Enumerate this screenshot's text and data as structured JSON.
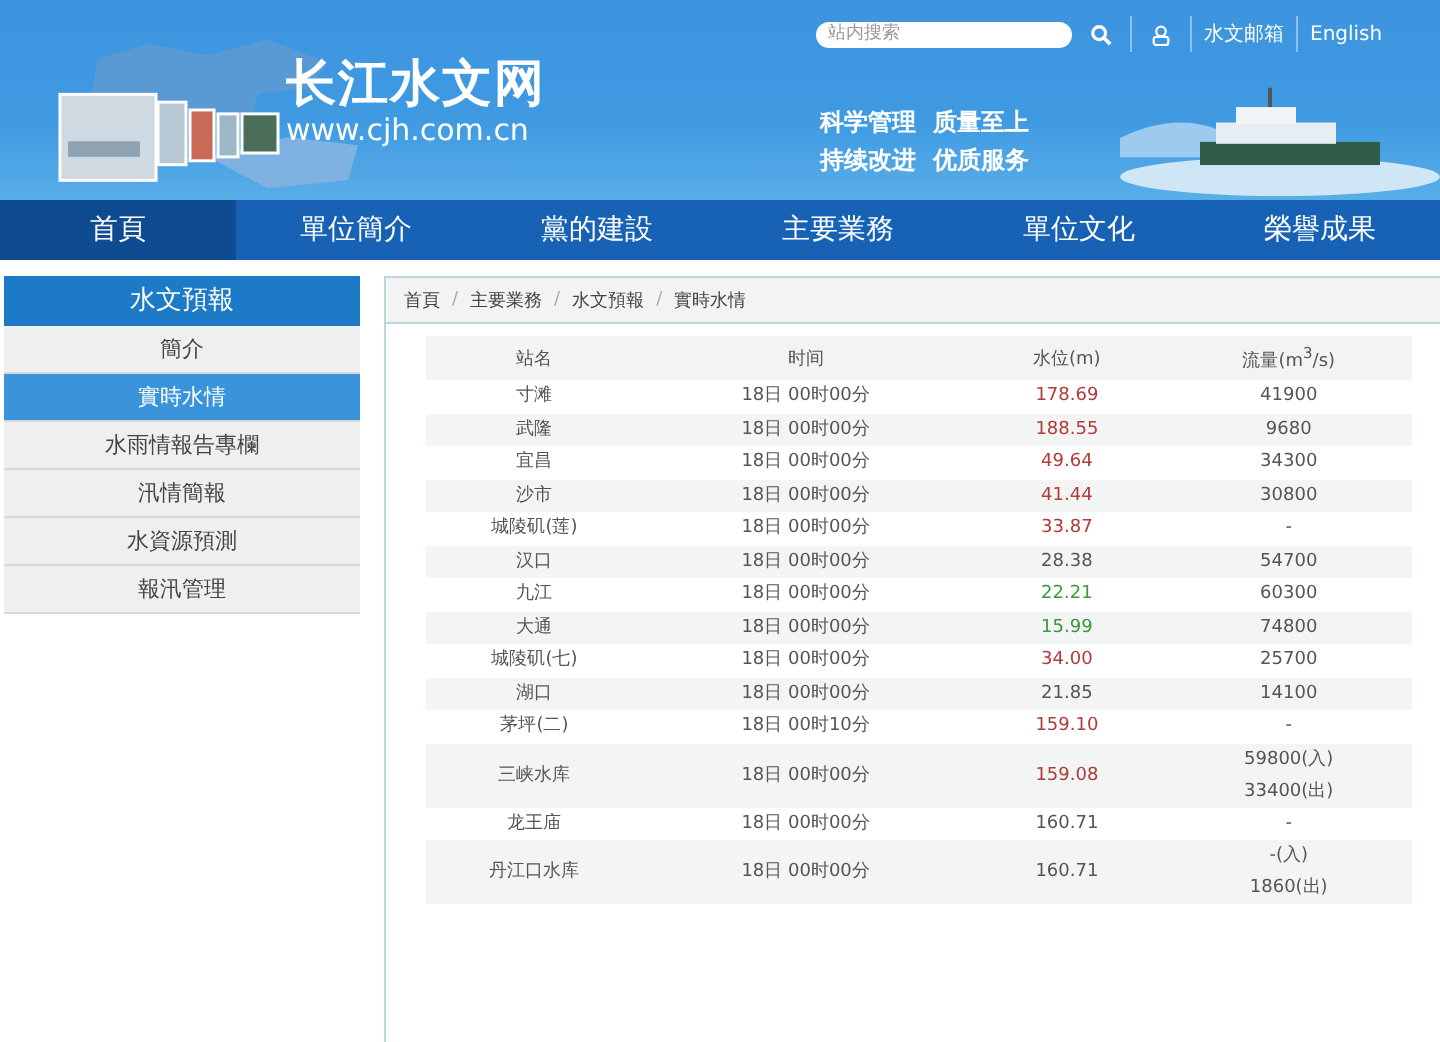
{
  "header": {
    "search": {
      "placeholder": "站内搜索"
    },
    "links": [
      "水文邮箱",
      "English"
    ],
    "logo_title": "长江水文网",
    "logo_url": "www.cjh.com.cn",
    "slogans": [
      "科学管理  质量至上",
      "持续改进  优质服务"
    ]
  },
  "nav": [
    {
      "label": "首頁",
      "selected": true
    },
    {
      "label": "單位簡介",
      "selected": false
    },
    {
      "label": "黨的建設",
      "selected": false
    },
    {
      "label": "主要業務",
      "selected": false
    },
    {
      "label": "單位文化",
      "selected": false
    },
    {
      "label": "榮譽成果",
      "selected": false
    }
  ],
  "sidebar": {
    "title": "水文預報",
    "items": [
      {
        "label": "簡介",
        "selected": false
      },
      {
        "label": "實時水情",
        "selected": true
      },
      {
        "label": "水雨情報告專欄",
        "selected": false
      },
      {
        "label": "汛情簡報",
        "selected": false
      },
      {
        "label": "水資源預測",
        "selected": false
      },
      {
        "label": "報汛管理",
        "selected": false
      }
    ]
  },
  "breadcrumb": [
    {
      "kind": "link",
      "text": "首頁"
    },
    {
      "kind": "separator",
      "text": "/"
    },
    {
      "kind": "link",
      "text": "主要業務"
    },
    {
      "kind": "separator",
      "text": "/"
    },
    {
      "kind": "link",
      "text": "水文預報"
    },
    {
      "kind": "separator",
      "text": "/"
    },
    {
      "kind": "link",
      "text": "實時水情"
    }
  ],
  "table": {
    "columns": [
      "站名",
      "时间",
      "水位(m)",
      "流量(m$^{3}$/s)"
    ],
    "rows": [
      {
        "station": "寸滩",
        "time": "18日 00时00分",
        "level_m": "178.69",
        "color": "#b23b3b",
        "flow": [
          "41900"
        ]
      },
      {
        "station": "武隆",
        "time": "18日 00时00分",
        "level_m": "188.55",
        "color": "#b23b3b",
        "flow": [
          "9680"
        ]
      },
      {
        "station": "宜昌",
        "time": "18日 00时00分",
        "level_m": "49.64",
        "color": "#b23b3b",
        "flow": [
          "34300"
        ]
      },
      {
        "station": "沙市",
        "time": "18日 00时00分",
        "level_m": "41.44",
        "color": "#b23b3b",
        "flow": [
          "30800"
        ]
      },
      {
        "station": "城陵矶(莲)",
        "time": "18日 00时00分",
        "level_m": "33.87",
        "color": "#b23b3b",
        "flow": [
          "-"
        ]
      },
      {
        "station": "汉口",
        "time": "18日 00时00分",
        "level_m": "28.38",
        "color": "#555555",
        "flow": [
          "54700"
        ]
      },
      {
        "station": "九江",
        "time": "18日 00时00分",
        "level_m": "22.21",
        "color": "#3a983a",
        "flow": [
          "60300"
        ]
      },
      {
        "station": "大通",
        "time": "18日 00时00分",
        "level_m": "15.99",
        "color": "#3a983a",
        "flow": [
          "74800"
        ]
      },
      {
        "station": "城陵矶(七)",
        "time": "18日 00时00分",
        "level_m": "34.00",
        "color": "#b23b3b",
        "flow": [
          "25700"
        ]
      },
      {
        "station": "湖口",
        "time": "18日 00时00分",
        "level_m": "21.85",
        "color": "#555555",
        "flow": [
          "14100"
        ]
      },
      {
        "station": "茅坪(二)",
        "time": "18日 00时10分",
        "level_m": "159.10",
        "color": "#b23b3b",
        "flow": [
          "-"
        ]
      },
      {
        "station": "三峡水库",
        "time": "18日 00时00分",
        "level_m": "159.08",
        "color": "#b23b3b",
        "flow": [
          "59800(入)",
          "33400(出)"
        ]
      },
      {
        "station": "龙王庙",
        "time": "18日 00时00分",
        "level_m": "160.71",
        "color": "#555555",
        "flow": [
          "-"
        ]
      },
      {
        "station": "丹江口水库",
        "time": "18日 00时00分",
        "level_m": "160.71",
        "color": "#555555",
        "flow": [
          "-(入)",
          "1860(出)"
        ]
      }
    ]
  }
}
